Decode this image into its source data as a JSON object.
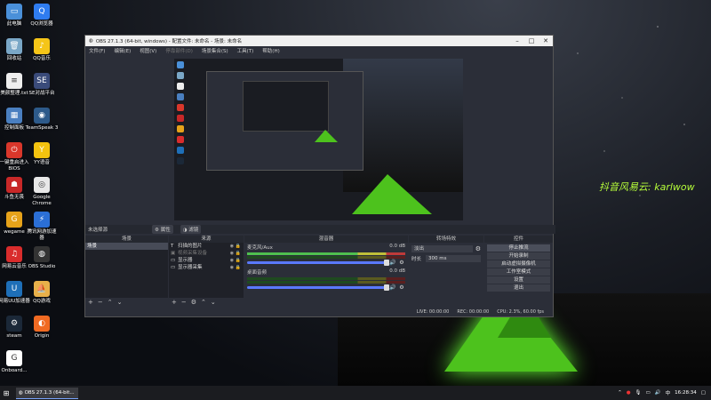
{
  "desktop": {
    "icons": [
      {
        "label": "此电脑",
        "color": "#4a90d9",
        "glyph": "▭"
      },
      {
        "label": "QQ浏览器",
        "color": "#2f7cf0",
        "glyph": "Q"
      },
      {
        "label": "回收站",
        "color": "#7aa7c7",
        "glyph": "🗑"
      },
      {
        "label": "QQ音乐",
        "color": "#f5c518",
        "glyph": "♪"
      },
      {
        "label": "美颜整理.txt",
        "color": "#eeeeee",
        "glyph": "≡"
      },
      {
        "label": "SE对战平台",
        "color": "#3a4b7a",
        "glyph": "SE"
      },
      {
        "label": "控制面板",
        "color": "#4a7fc0",
        "glyph": "▦"
      },
      {
        "label": "TeamSpeak 3",
        "color": "#2d5a8a",
        "glyph": "◉"
      },
      {
        "label": "一键重启进入BIOS",
        "color": "#d9372b",
        "glyph": "⏻"
      },
      {
        "label": "YY语音",
        "color": "#f4c30f",
        "glyph": "Y"
      },
      {
        "label": "斗鱼无畏",
        "color": "#c82828",
        "glyph": "☗"
      },
      {
        "label": "Google Chrome",
        "color": "#e8e8e8",
        "glyph": "◎"
      },
      {
        "label": "wegame",
        "color": "#e6a21a",
        "glyph": "G"
      },
      {
        "label": "腾讯网游加速器",
        "color": "#2b6fd6",
        "glyph": "⚡"
      },
      {
        "label": "网易云音乐",
        "color": "#d92c2c",
        "glyph": "♫"
      },
      {
        "label": "OBS Studio",
        "color": "#333333",
        "glyph": "◍"
      },
      {
        "label": "网易UU加速器",
        "color": "#1e6fb8",
        "glyph": "U"
      },
      {
        "label": "QQ游戏",
        "color": "#e8b04a",
        "glyph": "⛵"
      },
      {
        "label": "steam",
        "color": "#1b2838",
        "glyph": "⚙"
      },
      {
        "label": "Origin",
        "color": "#f06a22",
        "glyph": "◐"
      },
      {
        "label": "Onboard...",
        "color": "#ffffff",
        "glyph": "G"
      }
    ],
    "overlay_text": "抖音风易云: karlwow"
  },
  "taskbar": {
    "start_glyph": "⊞",
    "task_label": "OBS 27.1.3 (64-bit...",
    "time": "16:28:34"
  },
  "obs": {
    "title": "OBS 27.1.3 (64-bit, windows) - 配置文件: 未命名 - 场景: 未命名",
    "menu": [
      "文件(F)",
      "编辑(E)",
      "视图(V)",
      "停靠部件(D)",
      "场景集合(S)",
      "工具(T)",
      "帮助(H)"
    ],
    "source_bar": {
      "label": "未选择源",
      "properties": "属性",
      "filters": "滤镜"
    },
    "docks": {
      "scenes": {
        "title": "场景",
        "items": [
          "场景"
        ]
      },
      "sources": {
        "title": "来源",
        "items": [
          {
            "name": "扫描的图片",
            "active": true
          },
          {
            "name": "视频采集设备",
            "active": false
          },
          {
            "name": "显示器",
            "active": true
          },
          {
            "name": "显示器采集",
            "active": true
          }
        ]
      },
      "mixer": {
        "title": "混音器",
        "channels": [
          {
            "name": "麦克风/Aux",
            "db": "0.0 dB"
          },
          {
            "name": "桌面音频",
            "db": "0.0 dB"
          }
        ]
      },
      "transitions": {
        "title": "转场特效",
        "type": "淡出",
        "duration_label": "时长",
        "duration": "300 ms"
      },
      "controls": {
        "title": "控件",
        "buttons": [
          "停止推流",
          "开始录制",
          "启动虚拟摄像机",
          "工作室模式",
          "设置",
          "退出"
        ]
      }
    },
    "status": {
      "live": "LIVE: 00:00:00",
      "rec": "REC: 00:00:00",
      "cpu": "CPU: 2.3%, 60.00 fps"
    }
  }
}
